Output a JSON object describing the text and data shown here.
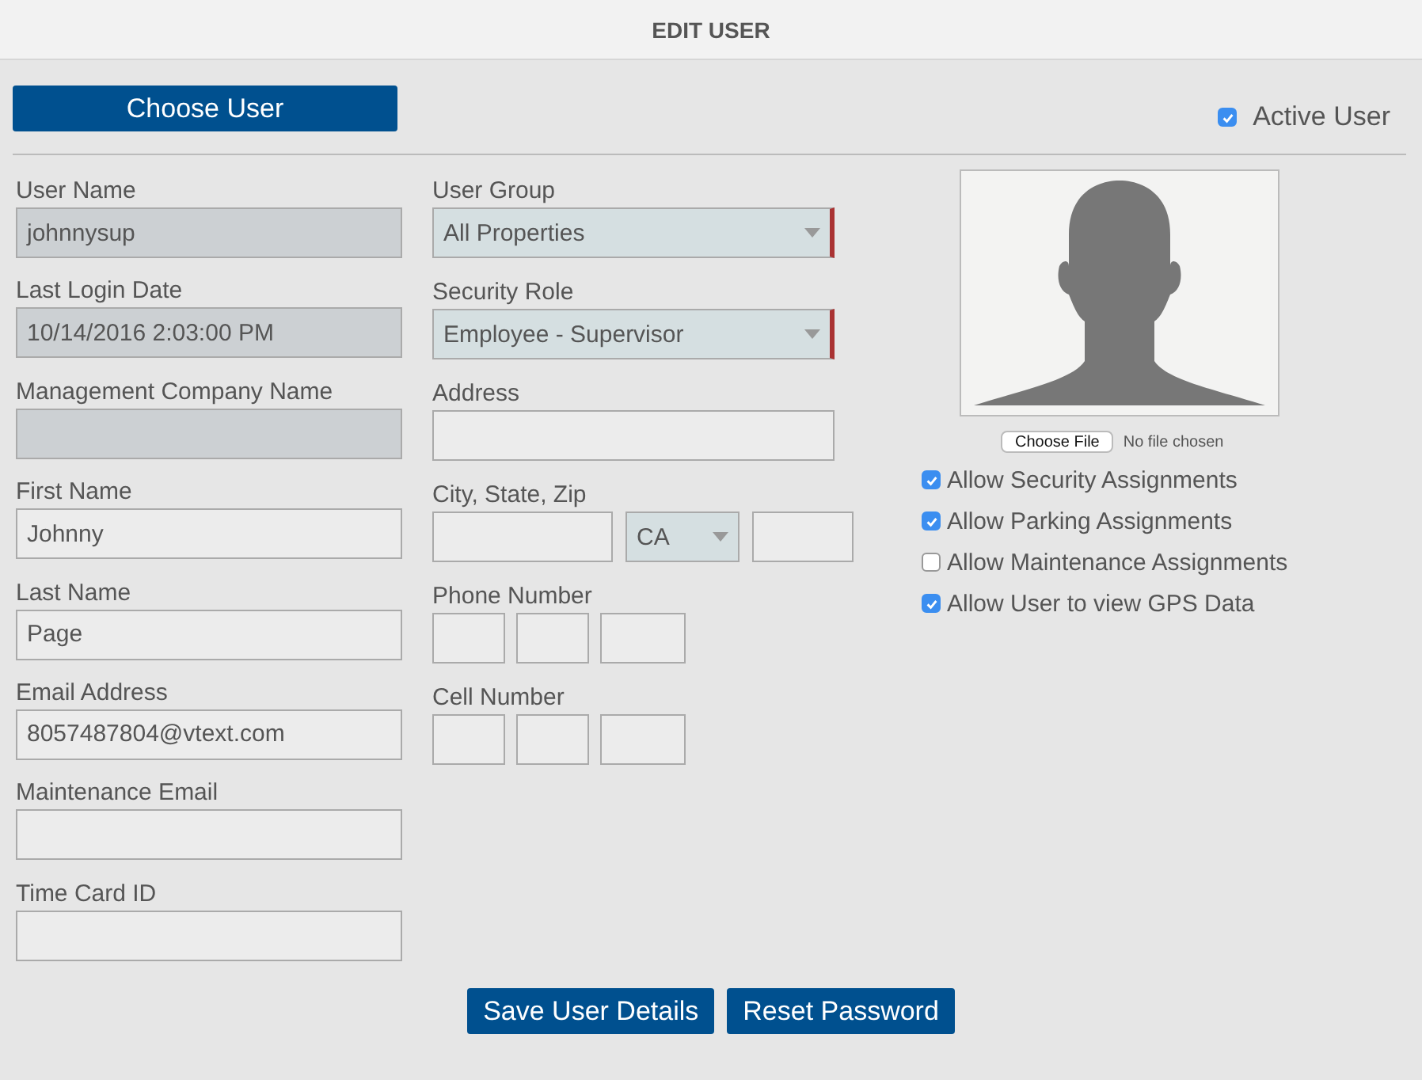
{
  "header": {
    "title": "EDIT USER"
  },
  "choose_user_button": "Choose User",
  "active_user": {
    "label": "Active User",
    "checked": true
  },
  "left_fields": [
    {
      "label": "User Name",
      "value": "johnnysup",
      "disabled": true
    },
    {
      "label": "Last Login Date",
      "value": "10/14/2016 2:03:00 PM",
      "disabled": true
    },
    {
      "label": "Management Company Name",
      "disabled": true
    },
    {
      "label": "First Name",
      "value": "Johnny",
      "disabled": false
    },
    {
      "label": "Last Name",
      "value": "Page",
      "disabled": false
    },
    {
      "label": "Email Address",
      "value": "8057487804@vtext.com",
      "disabled": false
    },
    {
      "label": "Maintenance Email",
      "disabled": false
    },
    {
      "label": "Time Card ID",
      "disabled": false
    }
  ],
  "middle_fields": [
    {
      "kind": "select",
      "label": "User Group",
      "value": "All Properties",
      "required": true
    },
    {
      "kind": "select",
      "label": "Security Role",
      "value": "Employee - Supervisor",
      "required": true
    },
    {
      "kind": "text",
      "label": "Address"
    },
    {
      "kind": "city",
      "label": "City, State, Zip",
      "state": "CA"
    },
    {
      "kind": "phone",
      "label": "Phone Number"
    },
    {
      "kind": "phone",
      "label": "Cell Number"
    }
  ],
  "photo": {
    "button": "Choose File",
    "status": "No file chosen"
  },
  "permissions": [
    {
      "label": "Allow Security Assignments",
      "checked": true
    },
    {
      "label": "Allow Parking Assignments",
      "checked": true
    },
    {
      "label": "Allow Maintenance Assignments",
      "checked": false
    },
    {
      "label": "Allow User to view GPS Data",
      "checked": true
    }
  ],
  "buttons": [
    "Save User Details",
    "Reset Password"
  ]
}
